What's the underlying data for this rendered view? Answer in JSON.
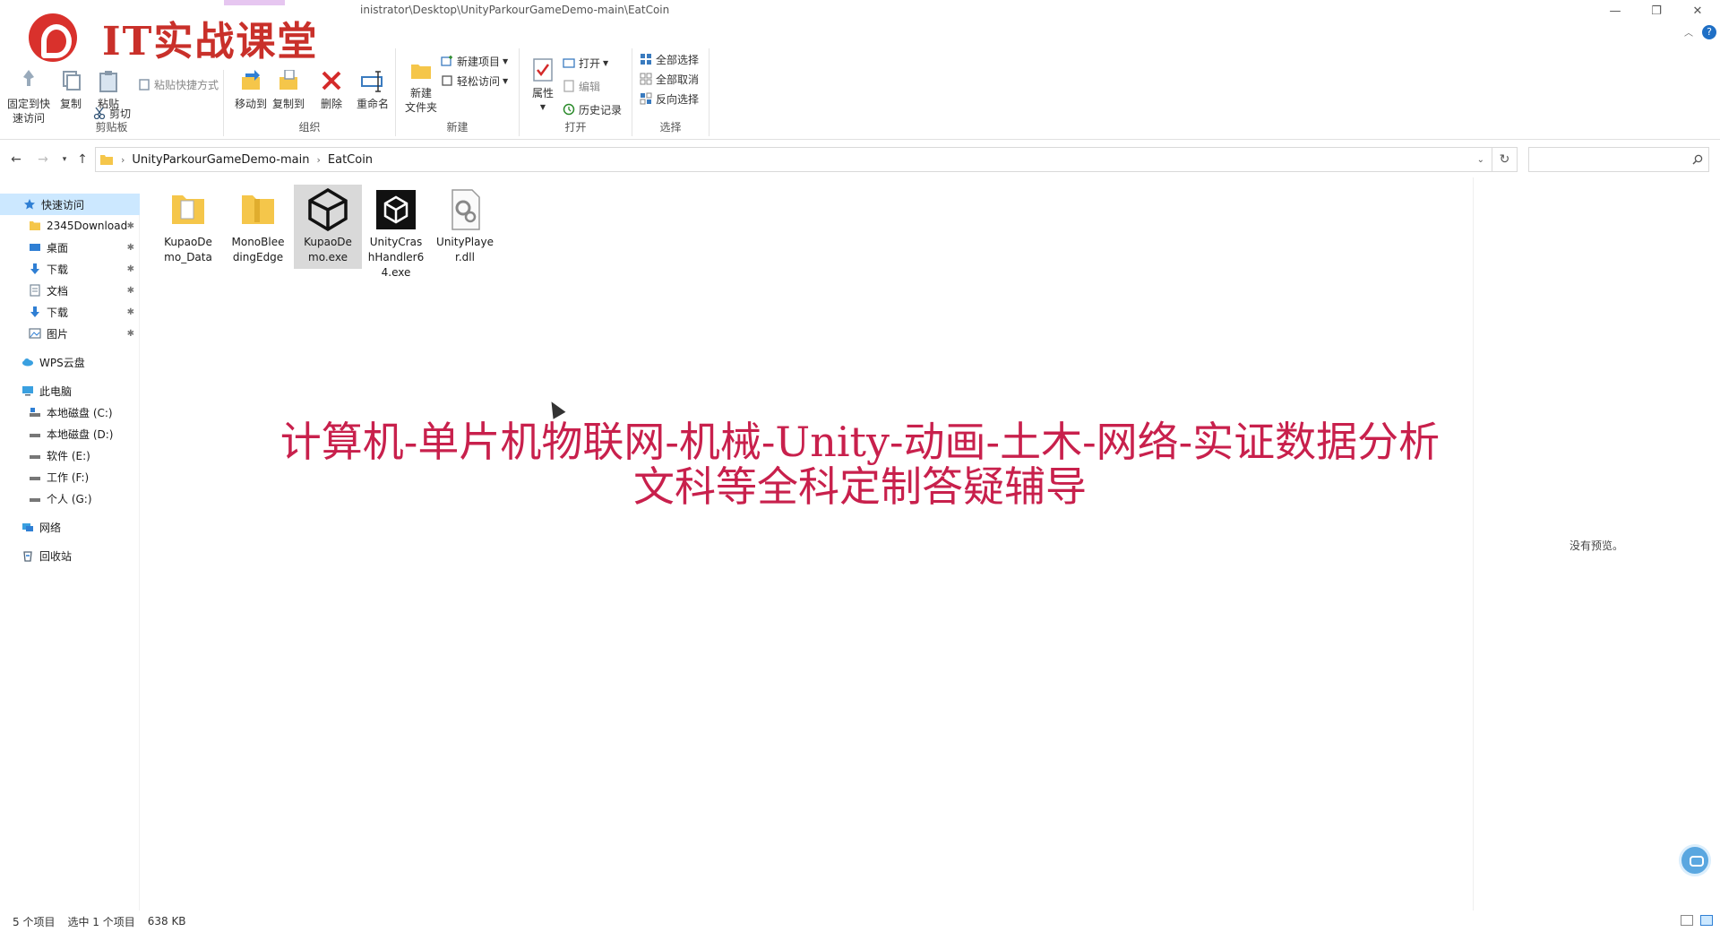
{
  "titlebar": {
    "path": "inistrator\\Desktop\\UnityParkourGameDemo-main\\EatCoin",
    "minimize": "—",
    "restore": "❐",
    "close": "✕"
  },
  "logo": {
    "text": "IT实战课堂"
  },
  "ribbon": {
    "clipboard": {
      "label": "剪贴板",
      "pin_quick": "固定到快\n速访问",
      "copy": "复制",
      "paste": "粘贴",
      "paste_shortcut": "粘贴快捷方式",
      "cut": "剪切"
    },
    "organize": {
      "label": "组织",
      "move_to": "移动到",
      "copy_to": "复制到",
      "delete": "删除",
      "rename": "重命名"
    },
    "new": {
      "label": "新建",
      "new_folder": "新建\n文件夹",
      "new_item": "新建项目",
      "easy_access": "轻松访问"
    },
    "open": {
      "label": "打开",
      "properties": "属性",
      "open": "打开",
      "edit": "编辑",
      "history": "历史记录"
    },
    "select": {
      "label": "选择",
      "select_all": "全部选择",
      "select_none": "全部取消",
      "invert": "反向选择"
    }
  },
  "address": {
    "segments": [
      "UnityParkourGameDemo-main",
      "EatCoin"
    ]
  },
  "sidebar": {
    "quick_access": "快速访问",
    "items": [
      {
        "label": "2345Download",
        "pinned": true
      },
      {
        "label": "桌面",
        "pinned": true
      },
      {
        "label": "下载",
        "pinned": true
      },
      {
        "label": "文档",
        "pinned": true
      },
      {
        "label": "下载",
        "pinned": true
      },
      {
        "label": "图片",
        "pinned": true
      }
    ],
    "wps": "WPS云盘",
    "this_pc": "此电脑",
    "drives": [
      "本地磁盘 (C:)",
      "本地磁盘 (D:)",
      "软件 (E:)",
      "工作 (F:)",
      "个人 (G:)"
    ],
    "network": "网络",
    "recycle": "回收站"
  },
  "files": [
    {
      "name": "KupaoDemo_Data",
      "line1": "KupaoDe",
      "line2": "mo_Data",
      "line3": "",
      "type": "folder"
    },
    {
      "name": "MonoBleedingEdge",
      "line1": "MonoBlee",
      "line2": "dingEdge",
      "line3": "",
      "type": "folder"
    },
    {
      "name": "KupaoDemo.exe",
      "line1": "KupaoDe",
      "line2": "mo.exe",
      "line3": "",
      "type": "unity-exe",
      "selected": true
    },
    {
      "name": "UnityCrashHandler64.exe",
      "line1": "UnityCras",
      "line2": "hHandler6",
      "line3": "4.exe",
      "type": "unity-crash"
    },
    {
      "name": "UnityPlayer.dll",
      "line1": "UnityPlaye",
      "line2": "r.dll",
      "line3": "",
      "type": "dll"
    }
  ],
  "preview": {
    "text": "没有预览。"
  },
  "watermark": {
    "line1": "计算机-单片机物联网-机械-Unity-动画-土木-网络-实证数据分析",
    "line2": "文科等全科定制答疑辅导"
  },
  "status": {
    "count": "5 个项目",
    "selected": "选中 1 个项目",
    "size": "638 KB"
  },
  "colors": {
    "accent": "#0078d7",
    "selection": "#cce8ff",
    "watermark": "#c8204c",
    "logo_red": "#c9302a"
  }
}
